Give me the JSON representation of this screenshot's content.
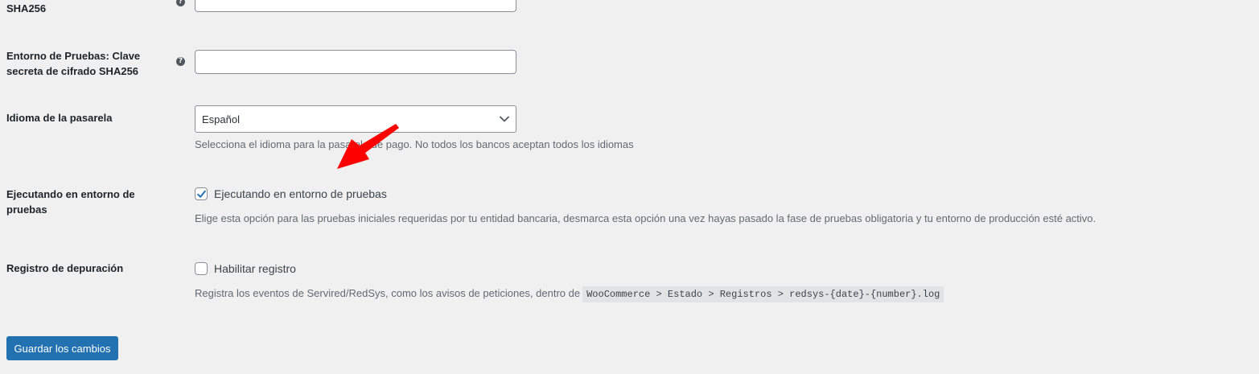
{
  "fields": {
    "sha256_prod": {
      "label": "SHA256"
    },
    "sha256_test": {
      "label_line1": "Entorno de Pruebas: Clave",
      "label_line2": "secreta de cifrado SHA256",
      "value": ""
    },
    "language": {
      "label": "Idioma de la pasarela",
      "selected": "Español",
      "description": "Selecciona el idioma para la pasarela de pago. No todos los bancos aceptan todos los idiomas"
    },
    "test_mode": {
      "label_line1": "Ejecutando en entorno de",
      "label_line2": "pruebas",
      "checkbox_label": "Ejecutando en entorno de pruebas",
      "checked": true,
      "description": "Elige esta opción para las pruebas iniciales requeridas por tu entidad bancaria, desmarca esta opción una vez hayas pasado la fase de pruebas obligatoria y tu entorno de producción esté activo."
    },
    "debug_log": {
      "label": "Registro de depuración",
      "checkbox_label": "Habilitar registro",
      "checked": false,
      "description": "Registra los eventos de Servired/RedSys, como los avisos de peticiones, dentro de",
      "code": "WooCommerce > Estado > Registros > redsys-{date}-{number}.log"
    }
  },
  "icons": {
    "help": "help-icon",
    "help_glyph": "?",
    "select_arrow": "chevron-down-icon",
    "check": "checkmark-icon",
    "annotation": "red-arrow-icon"
  },
  "actions": {
    "save_label": "Guardar los cambios"
  },
  "colors": {
    "background": "#f0f0f1",
    "primary": "#2271b1",
    "annotation_arrow": "#ff0000",
    "description_text": "#646970"
  }
}
